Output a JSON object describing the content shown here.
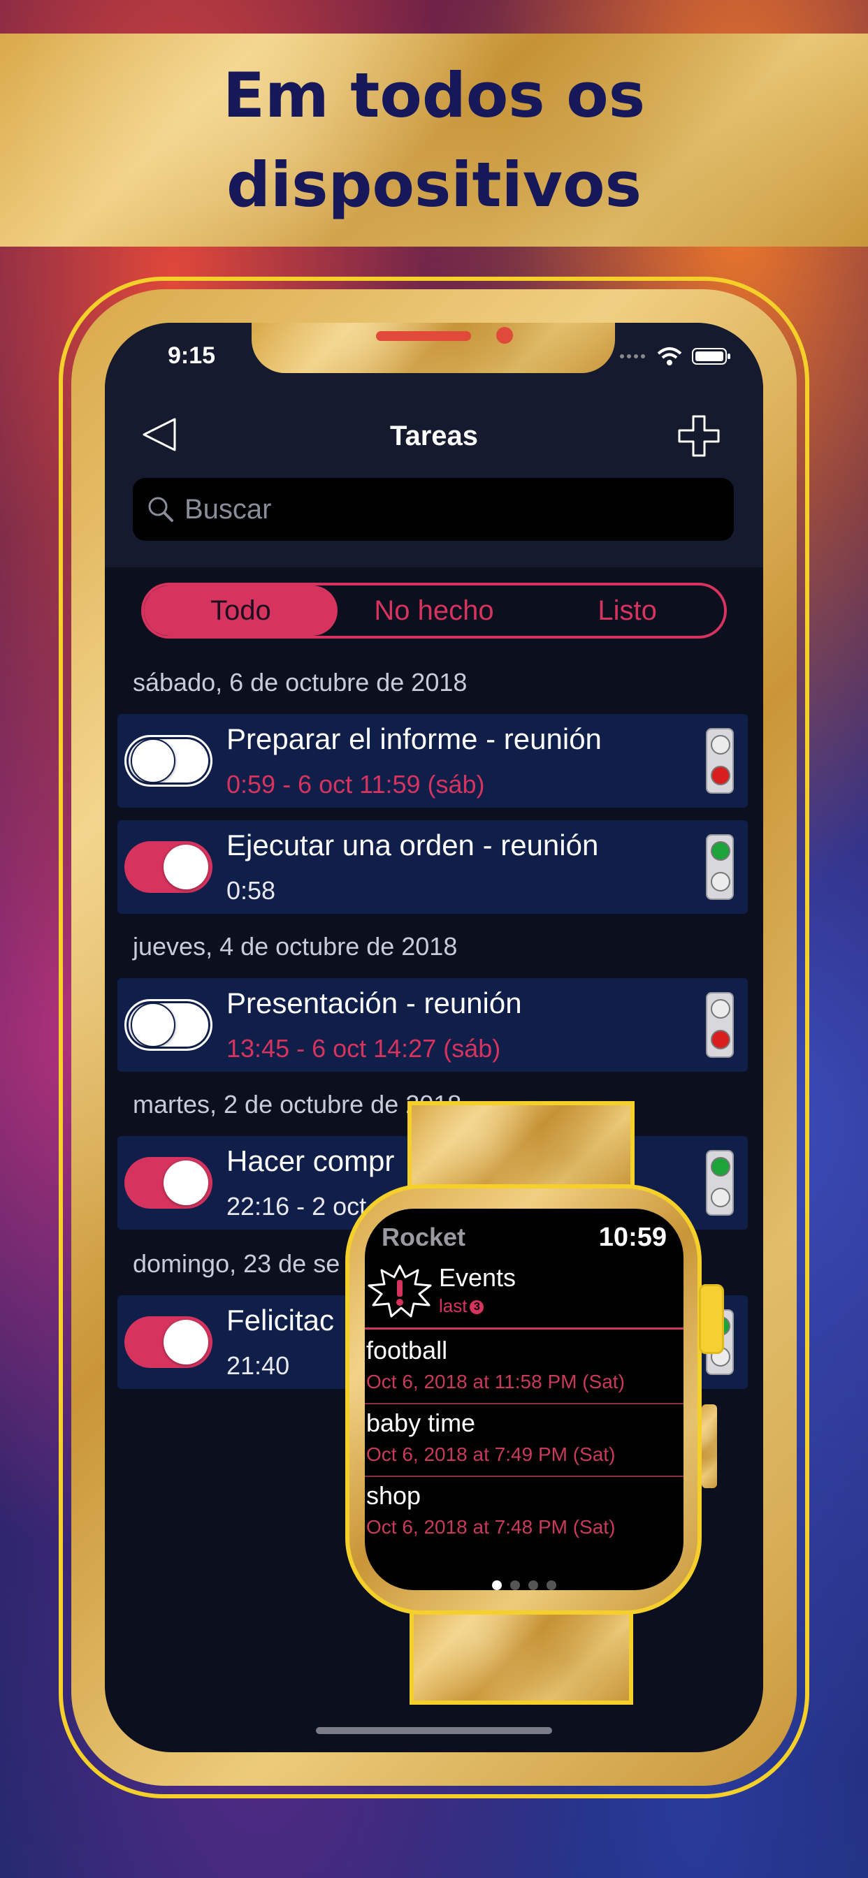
{
  "banner": {
    "title": "Em todos os dispositivos"
  },
  "status_bar": {
    "time": "9:15"
  },
  "header": {
    "title": "Tareas",
    "back_icon": "back-triangle-icon",
    "add_icon": "plus-icon"
  },
  "search": {
    "placeholder": "Buscar"
  },
  "segments": {
    "items": [
      "Todo",
      "No hecho",
      "Listo"
    ],
    "selected": "Todo"
  },
  "colors": {
    "accent": "#d6345e",
    "row_bg": "#0f1f4a",
    "screen_bg": "#0b0f1e",
    "banner_text": "#16185a"
  },
  "sections": [
    {
      "date": "sábado, 6 de octubre de 2018"
    },
    {
      "date": "jueves, 4 de octubre de 2018"
    },
    {
      "date": "martes, 2 de octubre de 2018"
    },
    {
      "date": "domingo, 23 de se"
    }
  ],
  "tasks": [
    {
      "title": "Preparar el informe - reunión",
      "subtitle": "0:59 - 6 oct 11:59 (sáb)",
      "done": false,
      "light": "red"
    },
    {
      "title": "Ejecutar una orden - reunión",
      "subtitle": "0:58",
      "done": true,
      "light": "green"
    },
    {
      "title": "Presentación - reunión",
      "subtitle": "13:45 - 6 oct 14:27 (sáb)",
      "done": false,
      "light": "red"
    },
    {
      "title": "Hacer compr",
      "subtitle": "22:16 - 2 oct",
      "done": true,
      "light": "green"
    },
    {
      "title": "Felicitac",
      "subtitle": "21:40",
      "done": true,
      "light": "green"
    }
  ],
  "watch": {
    "app_name": "Rocket",
    "time": "10:59",
    "events": {
      "title": "Events",
      "last": "last",
      "badge": "3"
    },
    "items": [
      {
        "title": "football",
        "subtitle": "Oct 6, 2018 at 11:58 PM (Sat)"
      },
      {
        "title": "baby time",
        "subtitle": "Oct 6, 2018 at 7:49 PM (Sat)"
      },
      {
        "title": "shop",
        "subtitle": "Oct 6, 2018 at 7:48 PM (Sat)"
      }
    ],
    "pages": 4,
    "current_page": 1
  }
}
